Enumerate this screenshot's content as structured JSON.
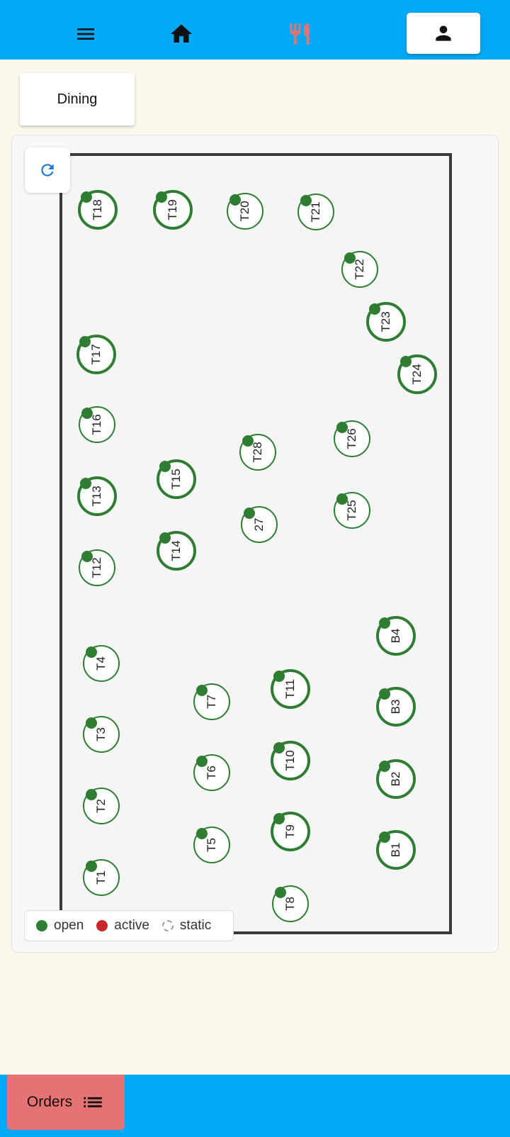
{
  "header": {
    "icons": [
      "menu-icon",
      "home-icon",
      "restaurant-icon",
      "person-icon"
    ],
    "accent_color": "#03a9f4",
    "restaurant_icon_color": "#e57373"
  },
  "floor_tab": {
    "label": "Dining"
  },
  "floor": {
    "refresh_icon": "refresh-icon",
    "tables": [
      {
        "label": "T18",
        "status": "open"
      },
      {
        "label": "T19",
        "status": "open"
      },
      {
        "label": "T20",
        "status": "open"
      },
      {
        "label": "T21",
        "status": "open"
      },
      {
        "label": "T22",
        "status": "open"
      },
      {
        "label": "T23",
        "status": "open"
      },
      {
        "label": "T24",
        "status": "open"
      },
      {
        "label": "T17",
        "status": "open"
      },
      {
        "label": "T16",
        "status": "open"
      },
      {
        "label": "T28",
        "status": "open"
      },
      {
        "label": "T26",
        "status": "open"
      },
      {
        "label": "T15",
        "status": "open"
      },
      {
        "label": "T13",
        "status": "open"
      },
      {
        "label": "27",
        "status": "open"
      },
      {
        "label": "T25",
        "status": "open"
      },
      {
        "label": "T14",
        "status": "open"
      },
      {
        "label": "T12",
        "status": "open"
      },
      {
        "label": "B4",
        "status": "open"
      },
      {
        "label": "T4",
        "status": "open"
      },
      {
        "label": "T11",
        "status": "open"
      },
      {
        "label": "T7",
        "status": "open"
      },
      {
        "label": "B3",
        "status": "open"
      },
      {
        "label": "T3",
        "status": "open"
      },
      {
        "label": "T10",
        "status": "open"
      },
      {
        "label": "T6",
        "status": "open"
      },
      {
        "label": "B2",
        "status": "open"
      },
      {
        "label": "T2",
        "status": "open"
      },
      {
        "label": "T9",
        "status": "open"
      },
      {
        "label": "T5",
        "status": "open"
      },
      {
        "label": "B1",
        "status": "open"
      },
      {
        "label": "T1",
        "status": "open"
      },
      {
        "label": "T8",
        "status": "open"
      }
    ],
    "status_colors": {
      "open": "#2e7d32",
      "active": "#c62828"
    }
  },
  "legend": {
    "open": "open",
    "active": "active",
    "static": "static"
  },
  "footer": {
    "orders_label": "Orders",
    "orders_icon": "list-icon"
  }
}
